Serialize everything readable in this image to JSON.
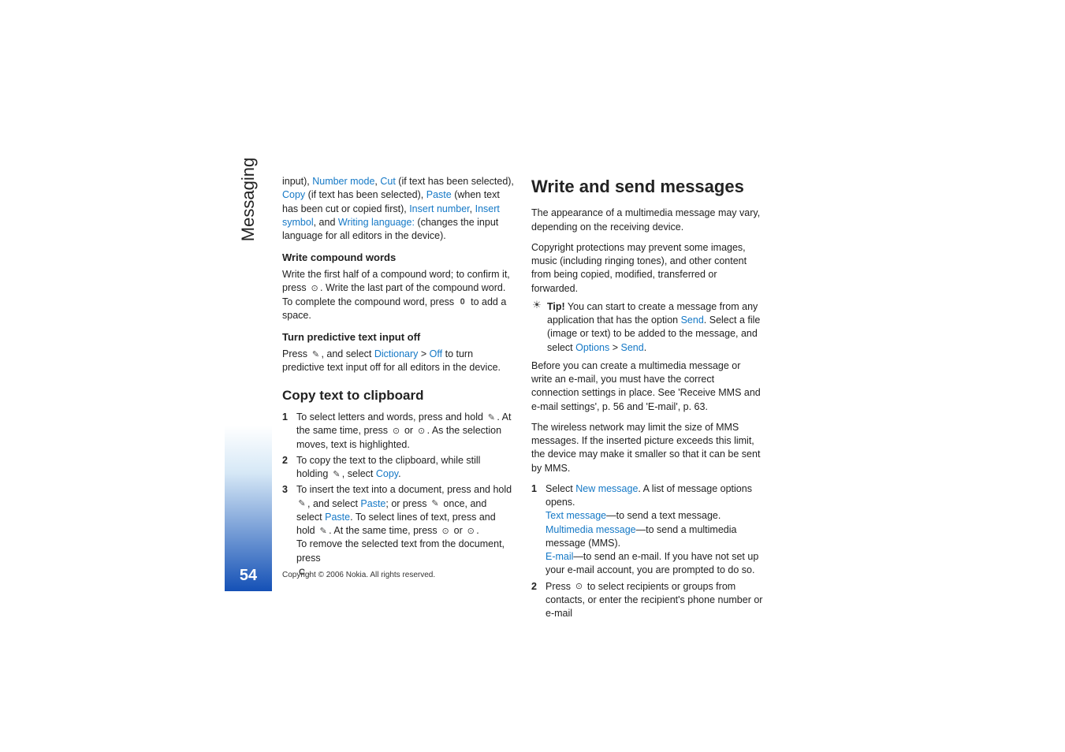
{
  "sidebar": {
    "label": "Messaging",
    "page": "54"
  },
  "left": {
    "intro_p1_a": "input), ",
    "intro_number_mode": "Number mode",
    "intro_cut": "Cut",
    "intro_p1_b": " (if text has been selected), ",
    "intro_copy": "Copy",
    "intro_p1_c": " (if text has been selected), ",
    "intro_paste": "Paste",
    "intro_p1_d": " (when text has been cut or copied first), ",
    "intro_insert_number": "Insert number",
    "intro_insert_symbol": "Insert symbol",
    "intro_p1_e": ", and ",
    "intro_writing_lang": "Writing language:",
    "intro_p1_f": " (changes the input language for all editors in the device).",
    "compound_h": "Write compound words",
    "compound_p_a": "Write the first half of a compound word; to confirm it, press ",
    "compound_p_b": ". Write the last part of the compound word. To complete the compound word, press ",
    "compound_p_c": " to add a space.",
    "predictive_h": "Turn predictive text input off",
    "predictive_p_a": "Press ",
    "predictive_p_b": ", and select ",
    "predictive_dict": "Dictionary",
    "predictive_gt": " > ",
    "predictive_off": "Off",
    "predictive_p_c": " to turn predictive text input off for all editors in the device.",
    "clipboard_h": "Copy text to clipboard",
    "clip_1_a": "To select letters and words, press and hold ",
    "clip_1_b": ". At the same time, press ",
    "clip_1_c": " or ",
    "clip_1_d": ". As the selection moves, text is highlighted.",
    "clip_2_a": "To copy the text to the clipboard, while still holding ",
    "clip_2_b": ", select ",
    "clip_2_copy": "Copy",
    "clip_2_c": ".",
    "clip_3_a": "To insert the text into a document, press and hold ",
    "clip_3_b": ", and select ",
    "clip_3_paste": "Paste",
    "clip_3_c": "; or press ",
    "clip_3_d": " once, and select ",
    "clip_3_paste2": "Paste",
    "clip_3_e": ". To select lines of text, press and hold ",
    "clip_3_f": ". At the same time, press ",
    "clip_3_g": " or ",
    "clip_3_h": ".",
    "clip_remove_a": "To remove the selected text from the document, press ",
    "clip_remove_b": "."
  },
  "right": {
    "heading": "Write and send messages",
    "p1": "The appearance of a multimedia message may vary, depending on the receiving device.",
    "p2": "Copyright protections may prevent some images, music (including ringing tones), and other content from being copied, modified, transferred or forwarded.",
    "tip_label": "Tip!",
    "tip_a": " You can start to create a message from any application that has the option ",
    "tip_send": "Send",
    "tip_b": ". Select a file (image or text) to be added to the message, and select ",
    "tip_options": "Options",
    "tip_gt": " > ",
    "tip_send2": "Send",
    "tip_c": ".",
    "p3": "Before you can create a multimedia message or write an e-mail, you must have the correct connection settings in place. See 'Receive MMS and e-mail settings', p. 56 and 'E-mail', p. 63.",
    "p4": "The wireless network may limit the size of MMS messages. If the inserted picture exceeds this limit, the device may make it smaller so that it can be sent by MMS.",
    "step1_a": "Select ",
    "step1_new": "New message",
    "step1_b": ". A list of message options opens.",
    "step1_text": "Text message",
    "step1_text_b": "—to send a text message.",
    "step1_mm": "Multimedia message",
    "step1_mm_b": "—to send a multimedia message (MMS).",
    "step1_email": "E-mail",
    "step1_email_b": "—to send an e-mail. If you have not set up your e-mail account, you are prompted to do so.",
    "step2_a": "Press ",
    "step2_b": " to select recipients or groups from contacts, or enter the recipient's phone number or e-mail"
  },
  "copyright": "Copyright © 2006 Nokia. All rights reserved."
}
